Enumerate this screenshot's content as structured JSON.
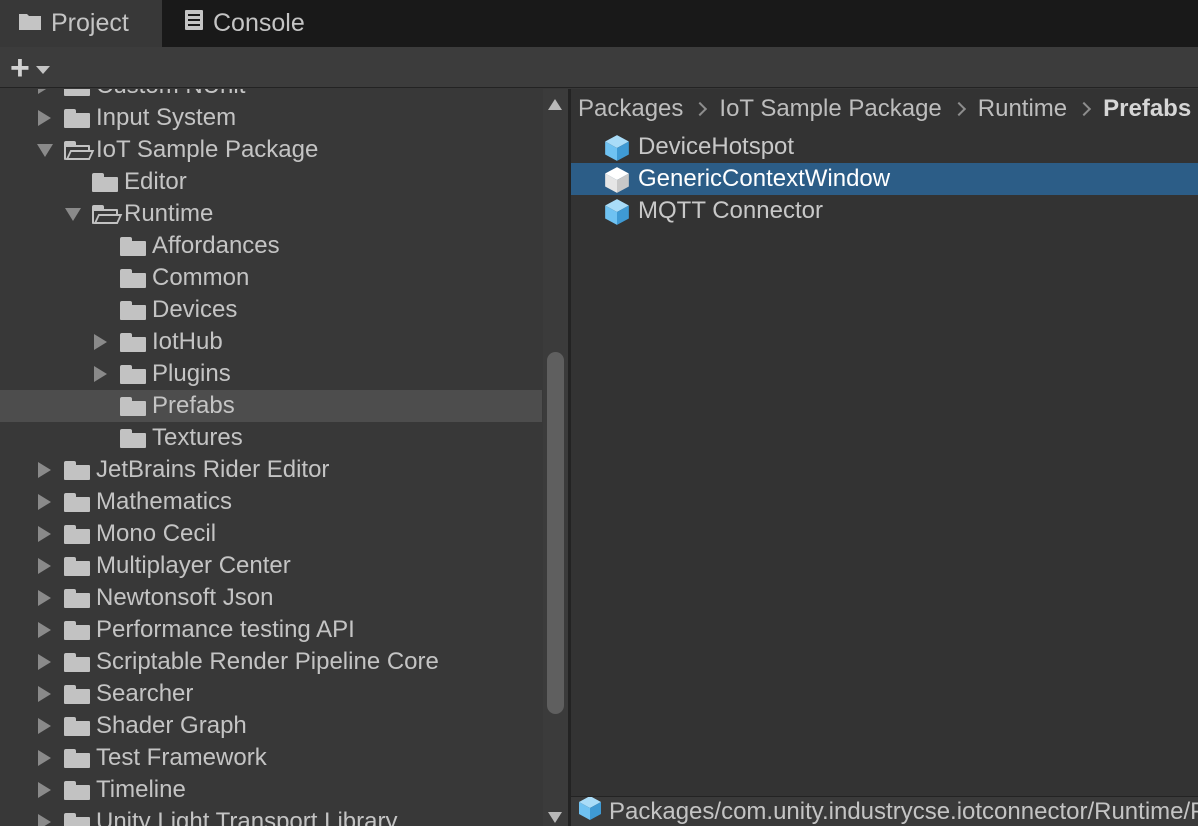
{
  "tabs": [
    {
      "label": "Project",
      "icon": "folder-icon",
      "active": true
    },
    {
      "label": "Console",
      "icon": "console-icon",
      "active": false
    }
  ],
  "toolbar": {
    "add_label": "+",
    "add_icon": "plus-icon"
  },
  "tree": {
    "items": [
      {
        "label": "Custom NUnit",
        "arrow": "right",
        "indent": 0,
        "open": false,
        "selected": false
      },
      {
        "label": "Input System",
        "arrow": "right",
        "indent": 0,
        "open": false,
        "selected": false
      },
      {
        "label": "IoT Sample Package",
        "arrow": "down",
        "indent": 0,
        "open": true,
        "selected": false
      },
      {
        "label": "Editor",
        "arrow": "none",
        "indent": 1,
        "open": false,
        "selected": false
      },
      {
        "label": "Runtime",
        "arrow": "down",
        "indent": 1,
        "open": true,
        "selected": false
      },
      {
        "label": "Affordances",
        "arrow": "none",
        "indent": 2,
        "open": false,
        "selected": false
      },
      {
        "label": "Common",
        "arrow": "none",
        "indent": 2,
        "open": false,
        "selected": false
      },
      {
        "label": "Devices",
        "arrow": "none",
        "indent": 2,
        "open": false,
        "selected": false
      },
      {
        "label": "IotHub",
        "arrow": "right",
        "indent": 2,
        "open": false,
        "selected": false
      },
      {
        "label": "Plugins",
        "arrow": "right",
        "indent": 2,
        "open": false,
        "selected": false
      },
      {
        "label": "Prefabs",
        "arrow": "none",
        "indent": 2,
        "open": false,
        "selected": true
      },
      {
        "label": "Textures",
        "arrow": "none",
        "indent": 2,
        "open": false,
        "selected": false
      },
      {
        "label": "JetBrains Rider Editor",
        "arrow": "right",
        "indent": 0,
        "open": false,
        "selected": false
      },
      {
        "label": "Mathematics",
        "arrow": "right",
        "indent": 0,
        "open": false,
        "selected": false
      },
      {
        "label": "Mono Cecil",
        "arrow": "right",
        "indent": 0,
        "open": false,
        "selected": false
      },
      {
        "label": "Multiplayer Center",
        "arrow": "right",
        "indent": 0,
        "open": false,
        "selected": false
      },
      {
        "label": "Newtonsoft Json",
        "arrow": "right",
        "indent": 0,
        "open": false,
        "selected": false
      },
      {
        "label": "Performance testing API",
        "arrow": "right",
        "indent": 0,
        "open": false,
        "selected": false
      },
      {
        "label": "Scriptable Render Pipeline Core",
        "arrow": "right",
        "indent": 0,
        "open": false,
        "selected": false
      },
      {
        "label": "Searcher",
        "arrow": "right",
        "indent": 0,
        "open": false,
        "selected": false
      },
      {
        "label": "Shader Graph",
        "arrow": "right",
        "indent": 0,
        "open": false,
        "selected": false
      },
      {
        "label": "Test Framework",
        "arrow": "right",
        "indent": 0,
        "open": false,
        "selected": false
      },
      {
        "label": "Timeline",
        "arrow": "right",
        "indent": 0,
        "open": false,
        "selected": false
      },
      {
        "label": "Unity Light Transport Library",
        "arrow": "right",
        "indent": 0,
        "open": false,
        "selected": false
      }
    ]
  },
  "breadcrumb": [
    "Packages",
    "IoT Sample Package",
    "Runtime",
    "Prefabs"
  ],
  "assets": [
    {
      "label": "DeviceHotspot",
      "icon": "prefab-cube-icon",
      "selected": false
    },
    {
      "label": "GenericContextWindow",
      "icon": "prefab-cube-icon",
      "selected": true
    },
    {
      "label": "MQTT Connector",
      "icon": "prefab-cube-icon",
      "selected": false
    }
  ],
  "status": {
    "path": "Packages/com.unity.industrycse.iotconnector/Runtime/Prefabs/GenericContextWindow.prefab",
    "icon": "prefab-cube-icon"
  },
  "colors": {
    "selection_blue": "#2c5d87",
    "row_selected": "#4d4d4d",
    "cube_blue": "#6fc2f2"
  }
}
